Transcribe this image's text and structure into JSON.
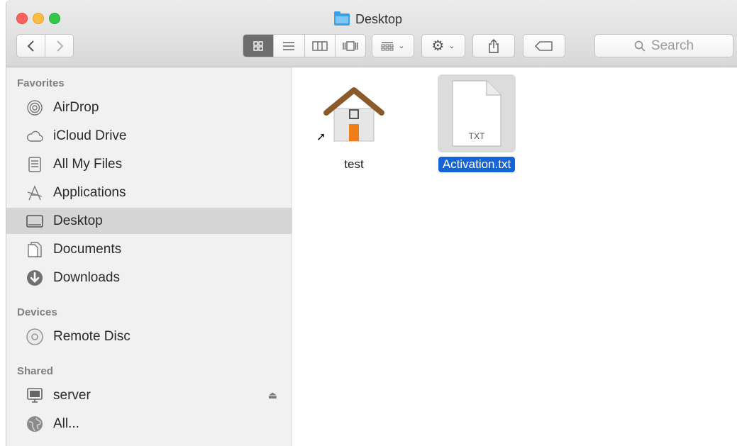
{
  "window": {
    "title": "Desktop"
  },
  "toolbar": {
    "back_icon": "‹",
    "forward_icon": "›",
    "view_icons": [
      "icon-view",
      "list-view",
      "column-view",
      "cover-flow-view"
    ],
    "search_placeholder": "Search"
  },
  "sidebar": {
    "favorites_header": "Favorites",
    "favorites": [
      {
        "label": "AirDrop",
        "icon": "airdrop-icon"
      },
      {
        "label": "iCloud Drive",
        "icon": "cloud-icon"
      },
      {
        "label": "All My Files",
        "icon": "all-files-icon"
      },
      {
        "label": "Applications",
        "icon": "applications-icon"
      },
      {
        "label": "Desktop",
        "icon": "desktop-icon",
        "selected": true
      },
      {
        "label": "Documents",
        "icon": "documents-icon"
      },
      {
        "label": "Downloads",
        "icon": "downloads-icon"
      }
    ],
    "devices_header": "Devices",
    "devices": [
      {
        "label": "Remote Disc",
        "icon": "disc-icon"
      }
    ],
    "shared_header": "Shared",
    "shared": [
      {
        "label": "server",
        "icon": "monitor-icon"
      },
      {
        "label": "All...",
        "icon": "network-icon"
      }
    ]
  },
  "files": [
    {
      "name": "test",
      "kind": "alias",
      "icon": "home-folder-icon"
    },
    {
      "name": "Activation.txt",
      "kind": "text",
      "icon": "txt-file-icon",
      "badge": "TXT",
      "selected": true
    }
  ],
  "colors": {
    "selection_blue": "#1565d6",
    "sidebar_bg": "#f1f1f1",
    "sidebar_selected": "#d5d5d5"
  }
}
